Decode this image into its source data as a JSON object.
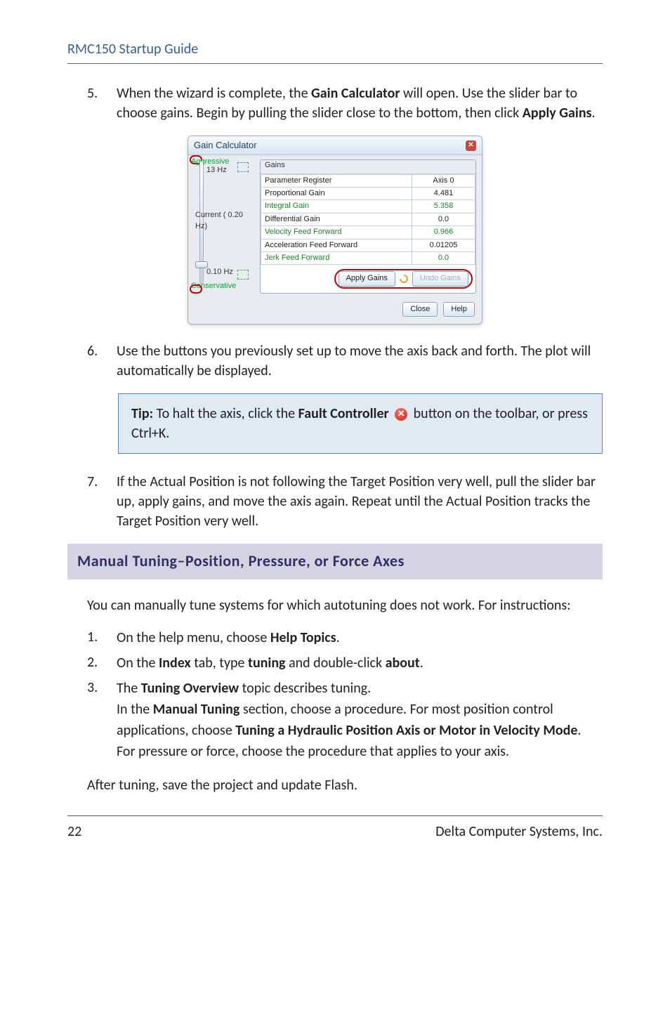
{
  "header": "RMC150 Startup Guide",
  "step5": {
    "num": "5.",
    "t1": "When the wizard is complete, the ",
    "b1": "Gain Calculator",
    "t2": " will open. Use the slider bar to choose gains. Begin by pulling the slider close to the bottom, then click ",
    "b2": "Apply Gains",
    "t3": "."
  },
  "gain_calc": {
    "title": "Gain Calculator",
    "gains_hdr": "Gains",
    "agg": "Aggressive",
    "cons": "Conservative",
    "freq_top": "13 Hz",
    "freq_mid_l": "Current (   0.20 Hz)",
    "freq_bot": "0.10 Hz",
    "rows": [
      {
        "n": "Parameter Register",
        "v": "Axis 0"
      },
      {
        "n": "Proportional Gain",
        "v": "4.481"
      },
      {
        "n": "Integral Gain",
        "v": "5.358",
        "green": true
      },
      {
        "n": "Differential Gain",
        "v": "0.0"
      },
      {
        "n": "Velocity Feed Forward",
        "v": "0.966",
        "green": true
      },
      {
        "n": "Acceleration Feed Forward",
        "v": "0.01205"
      },
      {
        "n": "Jerk Feed Forward",
        "v": "0.0",
        "green": true
      }
    ],
    "apply": "Apply Gains",
    "undo": "Undo Gains",
    "close": "Close",
    "help": "Help"
  },
  "step6": {
    "num": "6.",
    "t": "Use the buttons you previously set up to move the axis back and forth. The plot will automatically be displayed."
  },
  "tip": {
    "lead_b": "Tip: ",
    "t1": "To halt the axis, click the ",
    "b1": "Fault Controller",
    "t2": "  button on the toolbar, or press Ctrl+K."
  },
  "step7": {
    "num": "7.",
    "t": "If the Actual Position is not following the Target Position very well, pull the slider bar up, apply gains, and move the axis again. Repeat until the Actual Position tracks the Target Position very well."
  },
  "section": "Manual Tuning–Position, Pressure, or Force Axes",
  "intro": "You can manually tune systems for which autotuning does not work. For instructions:",
  "mt1": {
    "num": "1.",
    "pre": "On the help menu, choose ",
    "b": "Help Topics",
    "post": "."
  },
  "mt2": {
    "num": "2.",
    "t1": "On the ",
    "b1": "Index",
    "t2": " tab, type ",
    "b2": "tuning",
    "t3": " and double-click ",
    "b3": "about",
    "t4": "."
  },
  "mt3": {
    "num": "3.",
    "t1": "The ",
    "b1": "Tuning Overview",
    "t2": " topic describes tuning.",
    "t3": "In the ",
    "b2": "Manual Tuning",
    "t4": " section, choose a procedure. For most position control applications, choose ",
    "b3": "Tuning a Hydraulic Position Axis or Motor in Velocity Mode",
    "t5": ". For pressure or force, choose the procedure that applies to your axis."
  },
  "after": "After tuning, save the project and update Flash.",
  "footer_left": "22",
  "footer_right": "Delta Computer Systems, Inc."
}
